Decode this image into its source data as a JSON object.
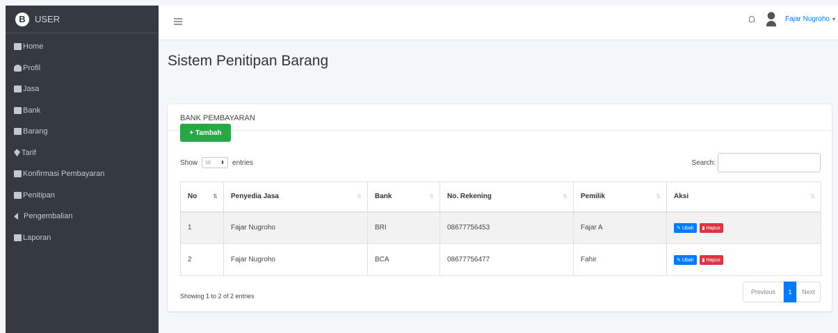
{
  "brand": {
    "logo_letter": "B",
    "name": "USER"
  },
  "sidebar": {
    "items": [
      {
        "icon": "table-icon",
        "label": "Home"
      },
      {
        "icon": "users-icon",
        "label": "Profil"
      },
      {
        "icon": "table-icon",
        "label": "Jasa"
      },
      {
        "icon": "bank-icon",
        "label": "Bank"
      },
      {
        "icon": "box-icon",
        "label": "Barang"
      },
      {
        "icon": "tag-icon",
        "label": "Tarif"
      },
      {
        "icon": "credit-card-icon",
        "label": "Konfirmasi Pembayaran"
      },
      {
        "icon": "list-icon",
        "label": "Penitipan"
      },
      {
        "icon": "backward-icon",
        "label": "Pengembalian"
      },
      {
        "icon": "report-icon",
        "label": "Laporan"
      }
    ]
  },
  "topbar": {
    "user_name": "Fajar Nugroho"
  },
  "page": {
    "title": "Sistem Penitipan Barang"
  },
  "card": {
    "header": "BANK PEMBAYARAN",
    "add_button": "+ Tambah",
    "show_label": "Show",
    "entries_label": "entries",
    "page_length": "10",
    "search_label": "Search:",
    "columns": [
      "No",
      "Penyedia Jasa",
      "Bank",
      "No. Rekening",
      "Pemilik",
      "Aksi"
    ],
    "rows": [
      {
        "no": "1",
        "penyedia": "Fajar Nugroho",
        "bank": "BRI",
        "rekening": "08677756453",
        "pemilik": "Fajar A"
      },
      {
        "no": "2",
        "penyedia": "Fajar Nugroho",
        "bank": "BCA",
        "rekening": "08677756477",
        "pemilik": "Fahir"
      }
    ],
    "edit_label": "Ubah",
    "delete_label": "Hapus",
    "info": "Showing 1 to 2 of 2 entries",
    "pager": {
      "previous": "Previous",
      "current": "1",
      "next": "Next"
    }
  },
  "colors": {
    "sidebar": "#343a40",
    "primary": "#007bff",
    "success": "#28a745",
    "danger": "#dc3545"
  }
}
